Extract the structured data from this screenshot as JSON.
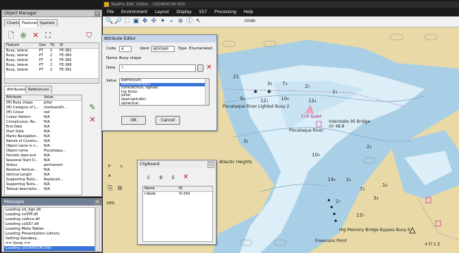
{
  "window_title": "SeaPro ENC Editor - US5NH01M.000",
  "menu": [
    "File",
    "Environment",
    "Layout",
    "Display",
    "S57",
    "Processing",
    "Help"
  ],
  "undo_label": "Undo",
  "object_manager": {
    "title": "Object Manager",
    "tabs": [
      "Charts",
      "Features",
      "Spatials"
    ],
    "feature_columns": [
      "Feature",
      "Geo",
      "TG",
      "ID"
    ],
    "features": [
      [
        "Buoy, lateral",
        "PT",
        "2",
        "FE-381"
      ],
      [
        "Buoy, lateral",
        "PT",
        "2",
        "FE-383"
      ],
      [
        "Buoy, lateral",
        "PT",
        "2",
        "FE-385"
      ],
      [
        "Buoy, lateral",
        "PT",
        "2",
        "FE-388"
      ],
      [
        "Buoy, lateral",
        "PT",
        "2",
        "FE-391"
      ]
    ],
    "attr_tabs": [
      "Attributes",
      "References"
    ],
    "attr_columns": [
      "Attribute",
      "Value"
    ],
    "attributes": [
      [
        "(M) Buoy shape",
        "pillar"
      ],
      [
        "(M) Category of L...",
        "starboard/h..."
      ],
      [
        "(M) Colour",
        "red"
      ],
      [
        "Colour Pattern",
        "N/A"
      ],
      [
        "Conspicuous, Ra...",
        "N/A"
      ],
      [
        "End Date",
        "N/A"
      ],
      [
        "Start Date",
        "N/A"
      ],
      [
        "Marks Navigation...",
        "N/A"
      ],
      [
        "Nature of Constru...",
        "N/A"
      ],
      [
        "Object name in n...",
        "N/A"
      ],
      [
        "Object name",
        "Piscataqua..."
      ],
      [
        "Periodic date end",
        "N/A"
      ],
      [
        "Seasonal Start D...",
        "N/A"
      ],
      [
        "Status",
        "permanent"
      ],
      [
        "Relative Vertical...",
        "N/A"
      ],
      [
        "Vertical Length",
        "N/A"
      ],
      [
        "Supporting Textu...",
        "Replaced..."
      ],
      [
        "Supporting Textu...",
        "N/A"
      ],
      [
        "Textual descriptio...",
        "N/A"
      ]
    ]
  },
  "messages": {
    "title": "Messages",
    "lines": [
      "Loading od_dgn.dll",
      "Loading coVPF.dll",
      "Loading coArcs.dll",
      "Loading coS57.dll",
      "Loading Meta Tables",
      "Loading Presentation Library",
      "Setting Geodesy...",
      "== Done ==",
      "Loading US5NH01M.000"
    ]
  },
  "attribute_editor": {
    "title": "Attribute Editor",
    "code_label": "Code",
    "code_value": "4",
    "ident_label": "Ident",
    "ident_value": "BOYSHP",
    "type_label": "Type",
    "type_value": "Enumerated",
    "name_label": "Name",
    "name_value": "Buoy shape",
    "data_label": "Data",
    "data_value": "2",
    "value_label": "Value",
    "options": [
      "barrel(tun)",
      "can(cylindrical)",
      "conical(nun, ogival)",
      "ice buoy",
      "pillar",
      "spar(spindle)",
      "spherical"
    ],
    "selected_index": 1,
    "ok_label": "OK",
    "cancel_label": "Cancel"
  },
  "clipboard": {
    "title": "Clipboard",
    "buttons": [
      "C",
      "B",
      "E"
    ],
    "columns": [
      "Name",
      "ID"
    ],
    "rows": [
      [
        "I-Node",
        "VI-254"
      ]
    ]
  },
  "side_labels": [
    "P",
    "L",
    "A",
    "DPS"
  ],
  "map": {
    "labels": [
      "Piscataqua River Lighted Buoy 2",
      "Piscataqua River",
      "Interstate 95 Bridge",
      "clr 48.8",
      "Fl R 4s4M",
      "Atlantic Heights",
      "Freemans Point",
      "Hig Memory Bridge Bypass Buoy 6",
      "4 Fl 1.5"
    ],
    "depths": [
      "21",
      "9₄",
      "12₁",
      "3₉",
      "7₃",
      "2₁",
      "10₉",
      "12₄",
      "1₁",
      "3₆",
      "10₀",
      "2₄",
      "14₆",
      "2₄",
      "1₈",
      "7₃",
      "13₇",
      "3₃",
      "2₇"
    ]
  },
  "colors": {
    "land": "#e8d9a6",
    "shallow": "#a9cfe6",
    "deep": "#dceef7",
    "accent": "#c2449e"
  }
}
